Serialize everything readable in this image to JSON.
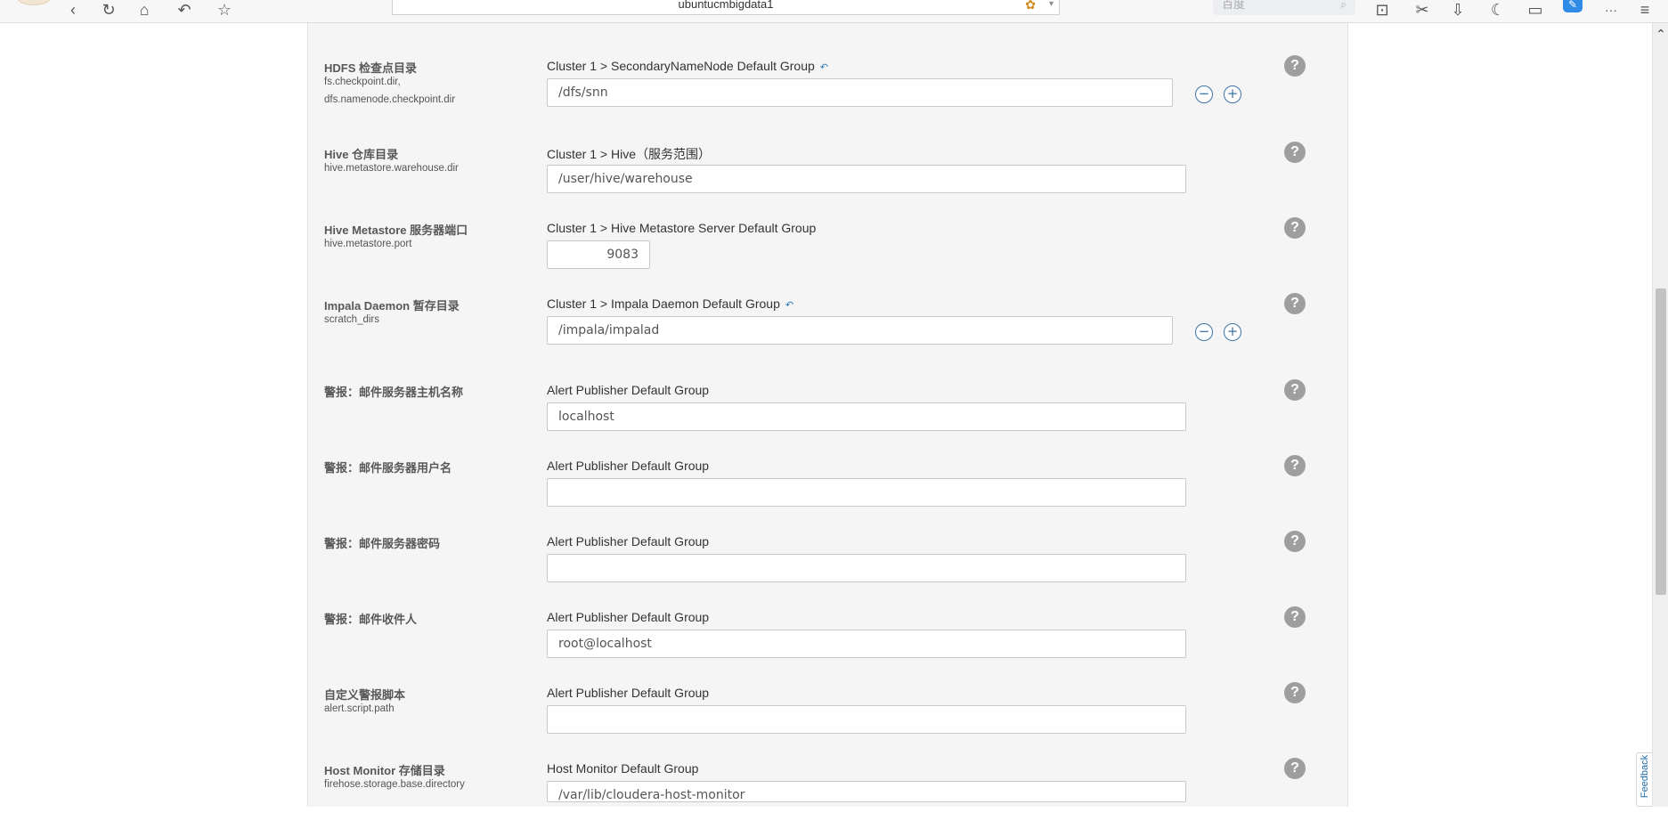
{
  "browser": {
    "url_text": "ubuntucmbigdata1",
    "search_placeholder": "百度",
    "more_label": "···"
  },
  "rows": [
    {
      "title": "HDFS 检查点目录",
      "keys": [
        "fs.checkpoint.dir,",
        "dfs.namenode.checkpoint.dir"
      ],
      "scope": "Cluster 1 > SecondaryNameNode Default Group",
      "value": "/dfs/snn"
    },
    {
      "title": "Hive 仓库目录",
      "keys": [
        "hive.metastore.warehouse.dir"
      ],
      "scope": "Cluster 1 > Hive（服务范围）",
      "value": "/user/hive/warehouse"
    },
    {
      "title": "Hive Metastore 服务器端口",
      "keys": [
        "hive.metastore.port"
      ],
      "scope": "Cluster 1 > Hive Metastore Server Default Group",
      "value": "9083"
    },
    {
      "title": "Impala Daemon 暂存目录",
      "keys": [
        "scratch_dirs"
      ],
      "scope": "Cluster 1 > Impala Daemon Default Group",
      "value": "/impala/impalad"
    },
    {
      "title": "警报：邮件服务器主机名称",
      "keys": [],
      "scope": "Alert Publisher Default Group",
      "value": "localhost"
    },
    {
      "title": "警报：邮件服务器用户名",
      "keys": [],
      "scope": "Alert Publisher Default Group",
      "value": ""
    },
    {
      "title": "警报：邮件服务器密码",
      "keys": [],
      "scope": "Alert Publisher Default Group",
      "value": ""
    },
    {
      "title": "警报：邮件收件人",
      "keys": [],
      "scope": "Alert Publisher Default Group",
      "value": "root@localhost"
    },
    {
      "title": "自定义警报脚本",
      "keys": [
        "alert.script.path"
      ],
      "scope": "Alert Publisher Default Group",
      "value": ""
    },
    {
      "title": "Host Monitor 存储目录",
      "keys": [
        "firehose.storage.base.directory"
      ],
      "scope": "Host Monitor Default Group",
      "value": "/var/lib/cloudera-host-monitor"
    }
  ],
  "common": {
    "help_label": "?",
    "minus_label": "−",
    "plus_label": "+",
    "revert_icon": "↶"
  },
  "feedback_label": "Feedback"
}
